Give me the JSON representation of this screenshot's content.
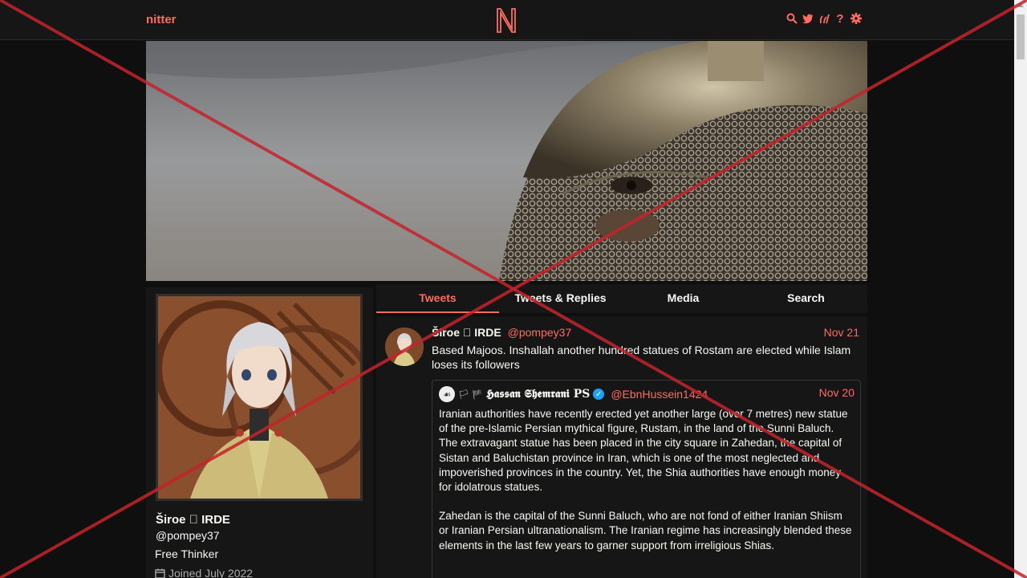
{
  "nav": {
    "brand": "nitter",
    "center_logo": "N",
    "icons": [
      "search-icon",
      "twitter-bird-icon",
      "rss-icon",
      "help-icon",
      "gear-icon"
    ]
  },
  "colors": {
    "accent": "#ff6c60",
    "background": "#0f0f0f",
    "panel": "#161616"
  },
  "profile": {
    "name": "Široe \u0000 IRDE",
    "handle": "@pompey37",
    "bio": "Free Thinker",
    "joined": "Joined July 2022"
  },
  "tabs": [
    {
      "label": "Tweets",
      "active": true
    },
    {
      "label": "Tweets & Replies",
      "active": false
    },
    {
      "label": "Media",
      "active": false
    },
    {
      "label": "Search",
      "active": false
    }
  ],
  "tweet": {
    "fullname": "Široe \u0000 IRDE",
    "username": "@pompey37",
    "date": "Nov 21",
    "text": "Based Majoos. Inshallah another hundred statues of Rostam are elected while Islam loses its followers",
    "quote": {
      "flags": "🏳 🏴",
      "fullname": "𝕳𝖆𝖘𝖘𝖆𝖓 𝕾𝖍𝖊𝖒𝖗𝖆𝖓𝖎 PS",
      "username": "@EbnHussein1424",
      "date": "Nov 20",
      "paragraph1": "Iranian authorities have recently erected yet another large (over 7 metres) new statue of the pre-Islamic Persian mythical figure, Rustam, in the land of the Sunni Baluch. The extravagant statue has been placed in the city square in Zahedan, the capital of Sistan and Baluchistan province in Iran, which is one of the most neglected and impoverished provinces in the country. Yet, the Shia authorities have enough money for idolatrous statues.",
      "paragraph2": "Zahedan is the capital of the Sunni Baluch, who are not fond of either Iranian Shiism or Iranian Persian ultranationalism. The Iranian regime has increasingly blended these elements in the last few years to garner support from irreligious Shias."
    }
  }
}
